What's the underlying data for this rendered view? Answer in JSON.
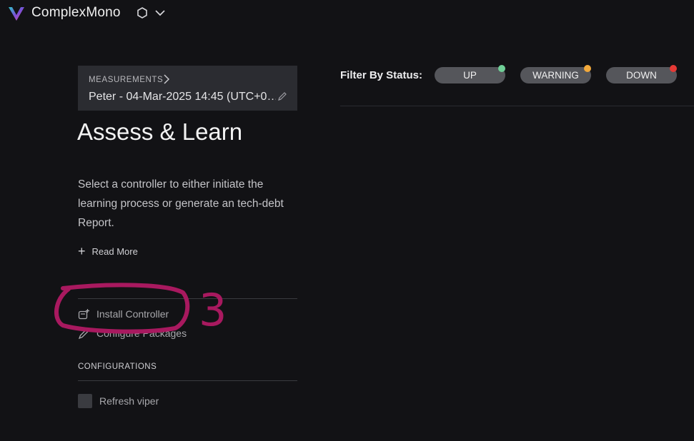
{
  "app": {
    "title": "ComplexMono",
    "logo_icon": "brand-v-logo",
    "workspace_icon": "hexagon-icon",
    "menu_icon": "chevron-down-icon",
    "logo_colors": [
      "#2ec5c9",
      "#7a4fd8",
      "#d94fa8"
    ]
  },
  "breadcrumb": {
    "label": "MEASUREMENTS",
    "value": "Peter - 04-Mar-2025 14:45 (UTC+0…",
    "edit_icon": "pencil-icon"
  },
  "main": {
    "title": "Assess & Learn",
    "description": "Select a controller to either initiate the learning process or generate an tech-debt Report.",
    "read_more": "Read More"
  },
  "actions": {
    "install_controller": "Install Controller",
    "configure_packages": "Configure Packages"
  },
  "configurations": {
    "heading": "CONFIGURATIONS",
    "refresh_label": "Refresh viper",
    "refresh_checked": false
  },
  "filter": {
    "label": "Filter By Status:",
    "statuses": [
      {
        "label": "UP",
        "color": "#6fcf97"
      },
      {
        "label": "WARNING",
        "color": "#f2a93b"
      },
      {
        "label": "DOWN",
        "color": "#e53935"
      }
    ]
  },
  "annotation": {
    "number": "3",
    "color": "#a8195f"
  }
}
